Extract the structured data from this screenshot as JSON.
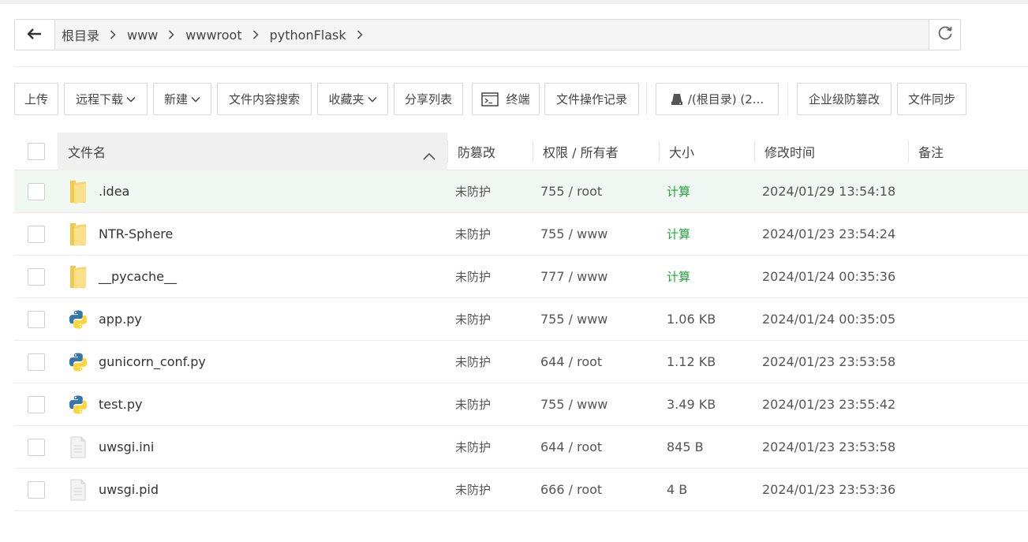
{
  "path": {
    "crumbs": [
      "根目录",
      "www",
      "wwwroot",
      "pythonFlask"
    ],
    "back_icon": "arrow-left-icon",
    "refresh_icon": "refresh-icon"
  },
  "toolbar": {
    "upload": "上传",
    "remote_download": "远程下载",
    "new": "新建",
    "content_search": "文件内容搜索",
    "favorites": "收藏夹",
    "share_list": "分享列表",
    "terminal": "终端",
    "operation_log": "文件操作记录",
    "disk": "/(根目录) (2...",
    "tamper_proof": "企业级防篡改",
    "file_sync": "文件同步"
  },
  "table": {
    "headers": {
      "name": "文件名",
      "protection": "防篡改",
      "perm_owner": "权限 / 所有者",
      "size": "大小",
      "mtime": "修改时间",
      "note": "备注"
    },
    "rows": [
      {
        "icon": "folder-icon",
        "name": ".idea",
        "protection": "未防护",
        "perm": "755 / root",
        "size": "计算",
        "mtime": "2024/01/29 13:54:18"
      },
      {
        "icon": "folder-icon",
        "name": "NTR-Sphere",
        "protection": "未防护",
        "perm": "755 / www",
        "size": "计算",
        "mtime": "2024/01/23 23:54:24"
      },
      {
        "icon": "folder-icon",
        "name": "__pycache__",
        "protection": "未防护",
        "perm": "777 / www",
        "size": "计算",
        "mtime": "2024/01/24 00:35:36"
      },
      {
        "icon": "python-file-icon",
        "name": "app.py",
        "protection": "未防护",
        "perm": "755 / www",
        "size": "1.06 KB",
        "mtime": "2024/01/24 00:35:05"
      },
      {
        "icon": "python-file-icon",
        "name": "gunicorn_conf.py",
        "protection": "未防护",
        "perm": "644 / root",
        "size": "1.12 KB",
        "mtime": "2024/01/23 23:53:58"
      },
      {
        "icon": "python-file-icon",
        "name": "test.py",
        "protection": "未防护",
        "perm": "755 / www",
        "size": "3.49 KB",
        "mtime": "2024/01/23 23:55:42"
      },
      {
        "icon": "text-file-icon",
        "name": "uwsgi.ini",
        "protection": "未防护",
        "perm": "644 / root",
        "size": "845 B",
        "mtime": "2024/01/23 23:53:58"
      },
      {
        "icon": "text-file-icon",
        "name": "uwsgi.pid",
        "protection": "未防护",
        "perm": "666 / root",
        "size": "4 B",
        "mtime": "2024/01/23 23:53:36"
      }
    ]
  },
  "colors": {
    "accent_green": "#20a53a",
    "folder_yellow": "#f7d774",
    "python_blue": "#3776ab",
    "python_yellow": "#ffd43b",
    "highlight_row": "#f1f8f4"
  }
}
